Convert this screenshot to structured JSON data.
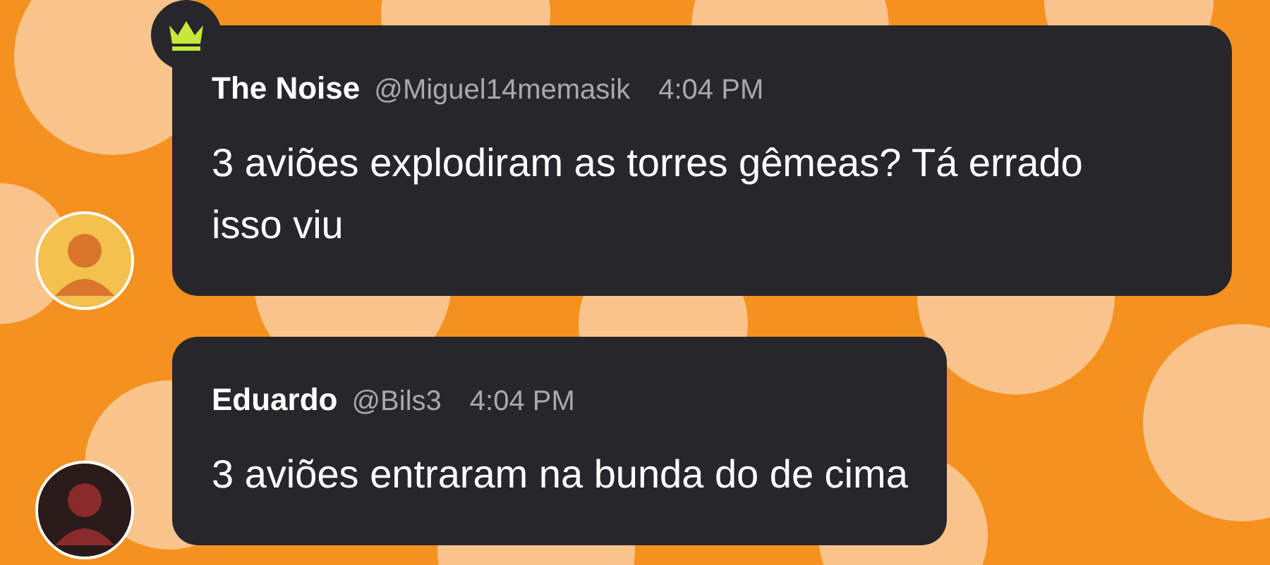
{
  "messages": [
    {
      "author": "The Noise",
      "handle": "@Miguel14memasik",
      "time": "4:04 PM",
      "text": "3 aviões explodiram as torres gêmeas? Tá errado isso viu",
      "leader": true
    },
    {
      "author": "Eduardo",
      "handle": "@Bils3",
      "time": "4:04 PM",
      "text": "3 aviões entraram na bunda do de cima",
      "leader": false
    }
  ]
}
